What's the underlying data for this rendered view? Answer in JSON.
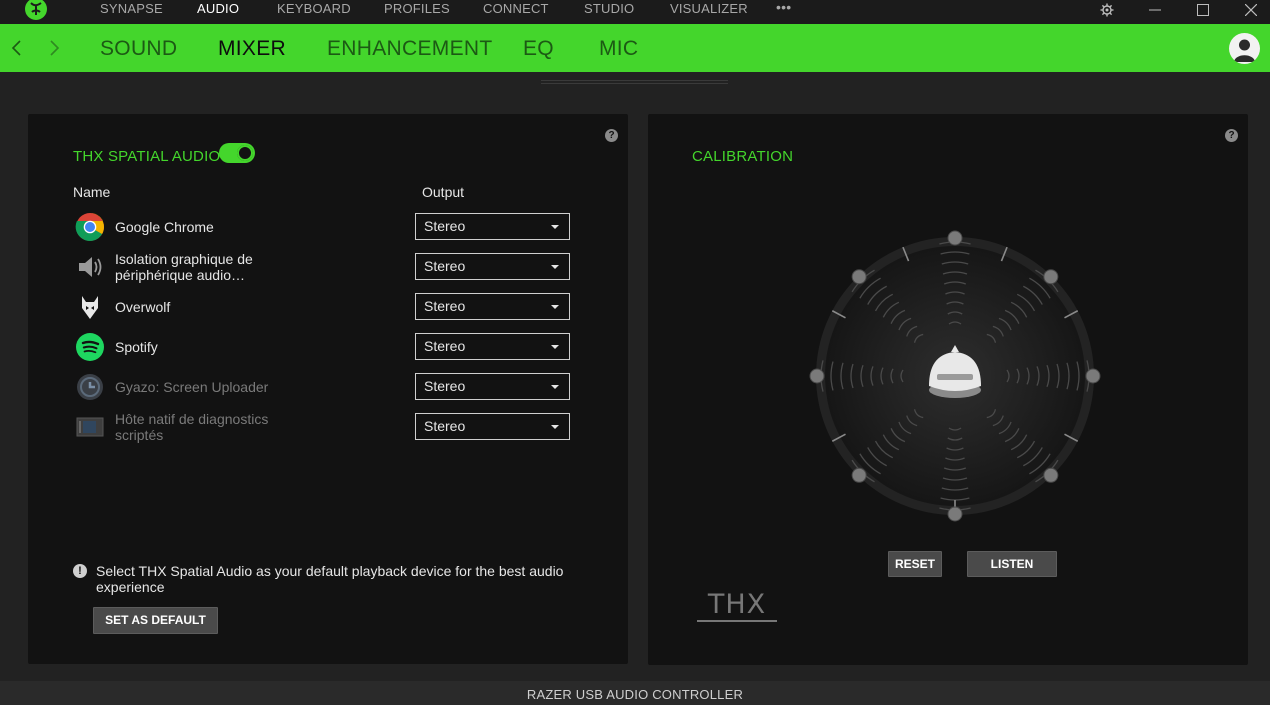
{
  "top_nav": {
    "items": [
      {
        "label": "SYNAPSE"
      },
      {
        "label": "AUDIO"
      },
      {
        "label": "KEYBOARD"
      },
      {
        "label": "PROFILES"
      },
      {
        "label": "CONNECT"
      },
      {
        "label": "STUDIO"
      },
      {
        "label": "VISUALIZER"
      }
    ],
    "more_label": "•••",
    "active": "AUDIO"
  },
  "sub_nav": {
    "items": [
      {
        "label": "SOUND"
      },
      {
        "label": "MIXER"
      },
      {
        "label": "ENHANCEMENT"
      },
      {
        "label": "EQ"
      },
      {
        "label": "MIC"
      }
    ],
    "active": "MIXER"
  },
  "colors": {
    "accent": "#44d62c",
    "panel": "#121212",
    "background": "#222222"
  },
  "mixer_panel": {
    "title": "THX SPATIAL AUDIO",
    "toggle_on": true,
    "help": "?",
    "col_name": "Name",
    "col_output": "Output",
    "apps": [
      {
        "name": "Google Chrome",
        "output": "Stereo",
        "icon": "chrome-icon",
        "dim": false
      },
      {
        "name": "Isolation graphique de périphérique audio…",
        "output": "Stereo",
        "icon": "speaker-icon",
        "dim": false
      },
      {
        "name": "Overwolf",
        "output": "Stereo",
        "icon": "overwolf-icon",
        "dim": false
      },
      {
        "name": "Spotify",
        "output": "Stereo",
        "icon": "spotify-icon",
        "dim": false
      },
      {
        "name": "Gyazo: Screen Uploader",
        "output": "Stereo",
        "icon": "gyazo-icon",
        "dim": true
      },
      {
        "name": "Hôte natif de diagnostics scriptés",
        "output": "Stereo",
        "icon": "diagnostics-icon",
        "dim": true
      }
    ],
    "info_icon": "!",
    "info_text": "Select THX Spatial Audio as your default playback device for the best audio experience",
    "set_default_label": "SET AS DEFAULT"
  },
  "calibration_panel": {
    "title": "CALIBRATION",
    "help": "?",
    "reset_label": "RESET",
    "listen_label": "LISTEN",
    "logo_text": "THX"
  },
  "status_bar": {
    "device": "RAZER USB AUDIO CONTROLLER"
  }
}
